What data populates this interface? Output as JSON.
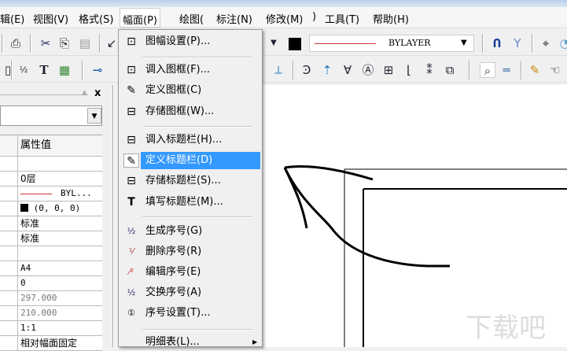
{
  "menubar": [
    "辑(E)",
    "视图(V)",
    "格式(S)",
    "幅面(P)",
    "绘图(",
    "标注(N)",
    "修改(M)",
    ")",
    "工具(T)",
    "帮助(H)"
  ],
  "toolbar": {
    "linetype": "BYLAYER"
  },
  "panel": {
    "close": "x",
    "header_value": "属性值",
    "rows": [
      "",
      "0层",
      "BYL...",
      "(0, 0, 0)",
      "标准",
      "标准",
      "",
      "A4",
      "0",
      "297.000",
      "210.000",
      "1:1",
      "相对幅面固定"
    ]
  },
  "menu": {
    "items": [
      {
        "label": "图幅设置(P)...",
        "icon": "frame-settings-icon"
      },
      {
        "label": "调入图框(F)...",
        "icon": "load-frame-icon"
      },
      {
        "label": "定义图框(C)",
        "icon": "define-frame-icon"
      },
      {
        "label": "存储图框(W)...",
        "icon": "save-frame-icon"
      },
      {
        "label": "调入标题栏(H)...",
        "icon": "load-titleblock-icon"
      },
      {
        "label": "定义标题栏(D)",
        "icon": "define-titleblock-icon"
      },
      {
        "label": "存储标题栏(S)...",
        "icon": "save-titleblock-icon"
      },
      {
        "label": "填写标题栏(M)...",
        "icon": "fill-titleblock-icon"
      },
      {
        "label": "生成序号(G)",
        "icon": "generate-number-icon"
      },
      {
        "label": "删除序号(R)",
        "icon": "delete-number-icon"
      },
      {
        "label": "编辑序号(E)",
        "icon": "edit-number-icon"
      },
      {
        "label": "交换序号(A)",
        "icon": "swap-number-icon"
      },
      {
        "label": "序号设置(T)...",
        "icon": "number-settings-icon"
      },
      {
        "label": "明细表(L)...",
        "icon": ""
      }
    ]
  },
  "colors": {
    "highlight": "#3399ff"
  }
}
